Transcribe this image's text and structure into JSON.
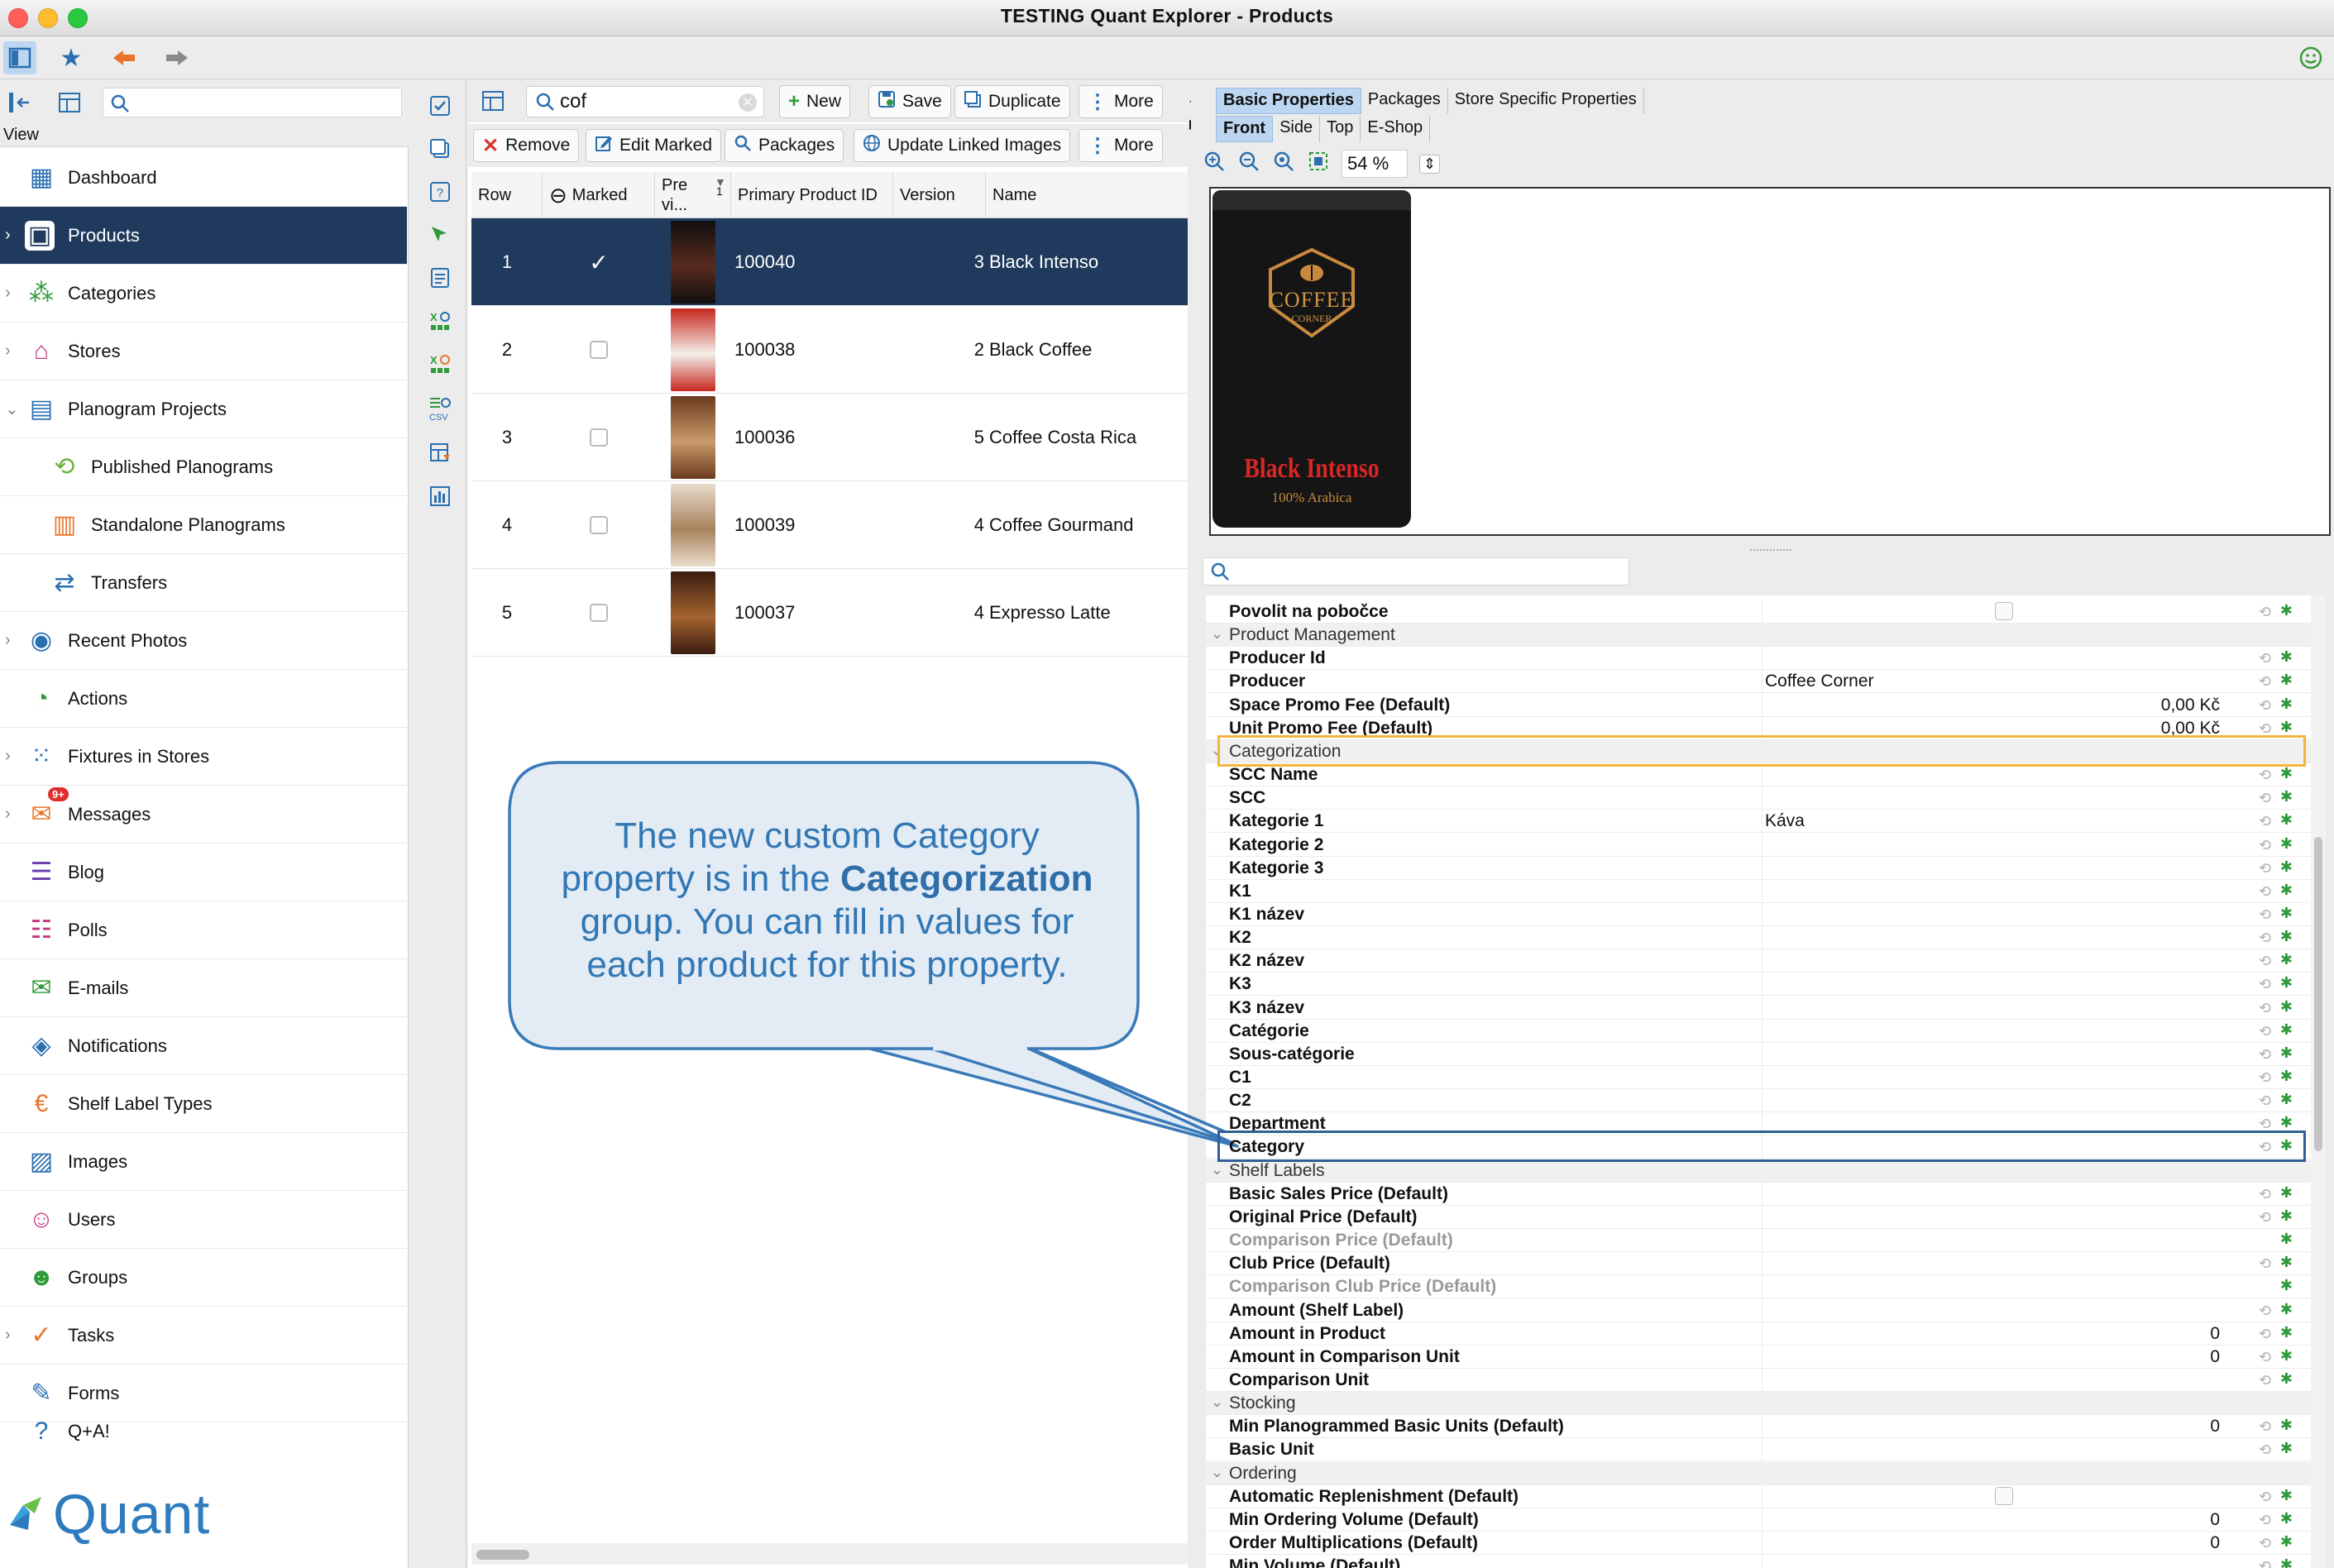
{
  "window": {
    "title": "TESTING Quant Explorer - Products"
  },
  "colors": {
    "selection": "#1f3a5c",
    "accent": "#2a6fb0",
    "callout_border": "#3a7ab8",
    "callout_fill": "#e3ecf5",
    "highlight_orange": "#f2b53b",
    "brand": "#2e7bbd"
  },
  "sidebar": {
    "view_label": "View",
    "items": [
      {
        "label": "Dashboard",
        "icon": "dashboard-icon"
      },
      {
        "label": "Products",
        "icon": "products-icon"
      },
      {
        "label": "Categories",
        "icon": "categories-icon"
      },
      {
        "label": "Stores",
        "icon": "stores-icon"
      },
      {
        "label": "Planogram Projects",
        "icon": "planogram-projects-icon"
      },
      {
        "label": "Published Planograms",
        "icon": "published-planograms-icon"
      },
      {
        "label": "Standalone Planograms",
        "icon": "standalone-planograms-icon"
      },
      {
        "label": "Transfers",
        "icon": "transfers-icon"
      },
      {
        "label": "Recent Photos",
        "icon": "camera-icon"
      },
      {
        "label": "Actions",
        "icon": "actions-icon"
      },
      {
        "label": "Fixtures in Stores",
        "icon": "fixtures-icon"
      },
      {
        "label": "Messages",
        "icon": "messages-icon"
      },
      {
        "label": "Blog",
        "icon": "blog-icon"
      },
      {
        "label": "Polls",
        "icon": "polls-icon"
      },
      {
        "label": "E-mails",
        "icon": "email-icon"
      },
      {
        "label": "Notifications",
        "icon": "notifications-icon"
      },
      {
        "label": "Shelf Label Types",
        "icon": "shelf-label-icon"
      },
      {
        "label": "Images",
        "icon": "images-icon"
      },
      {
        "label": "Users",
        "icon": "users-icon"
      },
      {
        "label": "Groups",
        "icon": "groups-icon"
      },
      {
        "label": "Tasks",
        "icon": "tasks-icon"
      },
      {
        "label": "Forms",
        "icon": "forms-icon"
      },
      {
        "label": "Q+A!",
        "icon": "qa-icon"
      }
    ],
    "messages_badge": "9+",
    "logo": "Quant"
  },
  "products": {
    "search_value": "cof",
    "toolbar1": {
      "new": "New",
      "save": "Save",
      "duplicate": "Duplicate",
      "more": "More"
    },
    "toolbar2": {
      "remove": "Remove",
      "edit_marked": "Edit Marked",
      "packages": "Packages",
      "update_linked_images": "Update Linked Images",
      "more": "More"
    },
    "columns": {
      "row": "Row",
      "marked": "Marked",
      "preview": "Pre vi...",
      "sort_index": "1",
      "primary_id": "Primary Product ID",
      "version": "Version",
      "name": "Name"
    },
    "rows": [
      {
        "row": "1",
        "marked": true,
        "id": "100040",
        "version": "3",
        "name": "Black Intenso"
      },
      {
        "row": "2",
        "marked": false,
        "id": "100038",
        "version": "2",
        "name": "Black Coffee"
      },
      {
        "row": "3",
        "marked": false,
        "id": "100036",
        "version": "5",
        "name": "Coffee Costa Rica"
      },
      {
        "row": "4",
        "marked": false,
        "id": "100039",
        "version": "4",
        "name": "Coffee Gourmand"
      },
      {
        "row": "5",
        "marked": false,
        "id": "100037",
        "version": "4",
        "name": "Expresso Latte"
      }
    ]
  },
  "details": {
    "tabs": [
      "Basic Properties",
      "Packages",
      "Store Specific Properties"
    ],
    "view_tabs": [
      "Front",
      "Side",
      "Top",
      "E-Shop"
    ],
    "zoom": "54 %",
    "product_image": {
      "brand": "COFFEE",
      "brand_sub": "CORNER",
      "name": "Black Intenso",
      "tag": "100% Arabica"
    }
  },
  "properties": [
    {
      "type": "prop",
      "name": "Povolit na pobočce",
      "checkbox": true
    },
    {
      "type": "group",
      "name": "Product Management"
    },
    {
      "type": "prop",
      "name": "Producer Id"
    },
    {
      "type": "prop",
      "name": "Producer",
      "value": "Coffee Corner"
    },
    {
      "type": "prop",
      "name": "Space Promo Fee (Default)",
      "right": "0,00 Kč"
    },
    {
      "type": "prop",
      "name": "Unit Promo Fee (Default)",
      "right": "0,00 Kč"
    },
    {
      "type": "group",
      "name": "Categorization",
      "highlight": "orange"
    },
    {
      "type": "prop",
      "name": "SCC Name"
    },
    {
      "type": "prop",
      "name": "SCC"
    },
    {
      "type": "prop",
      "name": "Kategorie 1",
      "value": "Káva"
    },
    {
      "type": "prop",
      "name": "Kategorie 2"
    },
    {
      "type": "prop",
      "name": "Kategorie 3"
    },
    {
      "type": "prop",
      "name": "K1"
    },
    {
      "type": "prop",
      "name": "K1 název"
    },
    {
      "type": "prop",
      "name": "K2"
    },
    {
      "type": "prop",
      "name": "K2 název"
    },
    {
      "type": "prop",
      "name": "K3"
    },
    {
      "type": "prop",
      "name": "K3 název"
    },
    {
      "type": "prop",
      "name": "Catégorie"
    },
    {
      "type": "prop",
      "name": "Sous-catégorie"
    },
    {
      "type": "prop",
      "name": "C1"
    },
    {
      "type": "prop",
      "name": "C2"
    },
    {
      "type": "prop",
      "name": "Department"
    },
    {
      "type": "prop",
      "name": "Category",
      "highlight": "blue"
    },
    {
      "type": "group",
      "name": "Shelf Labels"
    },
    {
      "type": "prop",
      "name": "Basic Sales Price (Default)"
    },
    {
      "type": "prop",
      "name": "Original Price (Default)"
    },
    {
      "type": "prop",
      "name": "Comparison Price (Default)",
      "dim": true
    },
    {
      "type": "prop",
      "name": "Club Price (Default)"
    },
    {
      "type": "prop",
      "name": "Comparison Club Price (Default)",
      "dim": true
    },
    {
      "type": "prop",
      "name": "Amount (Shelf Label)"
    },
    {
      "type": "prop",
      "name": "Amount in Product",
      "right": "0"
    },
    {
      "type": "prop",
      "name": "Amount in Comparison Unit",
      "right": "0"
    },
    {
      "type": "prop",
      "name": "Comparison Unit"
    },
    {
      "type": "group",
      "name": "Stocking"
    },
    {
      "type": "prop",
      "name": "Min Planogrammed Basic Units (Default)",
      "right": "0"
    },
    {
      "type": "prop",
      "name": "Basic Unit"
    },
    {
      "type": "group",
      "name": "Ordering"
    },
    {
      "type": "prop",
      "name": "Automatic Replenishment (Default)",
      "checkbox": true
    },
    {
      "type": "prop",
      "name": "Min Ordering Volume (Default)",
      "right": "0"
    },
    {
      "type": "prop",
      "name": "Order Multiplications (Default)",
      "right": "0"
    },
    {
      "type": "prop",
      "name": "Min Volume (Default)"
    }
  ],
  "callout": {
    "line1": "The new custom Category",
    "line2_pre": "property is in the ",
    "line2_bold": "Categorization",
    "line3": "group. You can fill in values for",
    "line4": "each product for this property."
  }
}
